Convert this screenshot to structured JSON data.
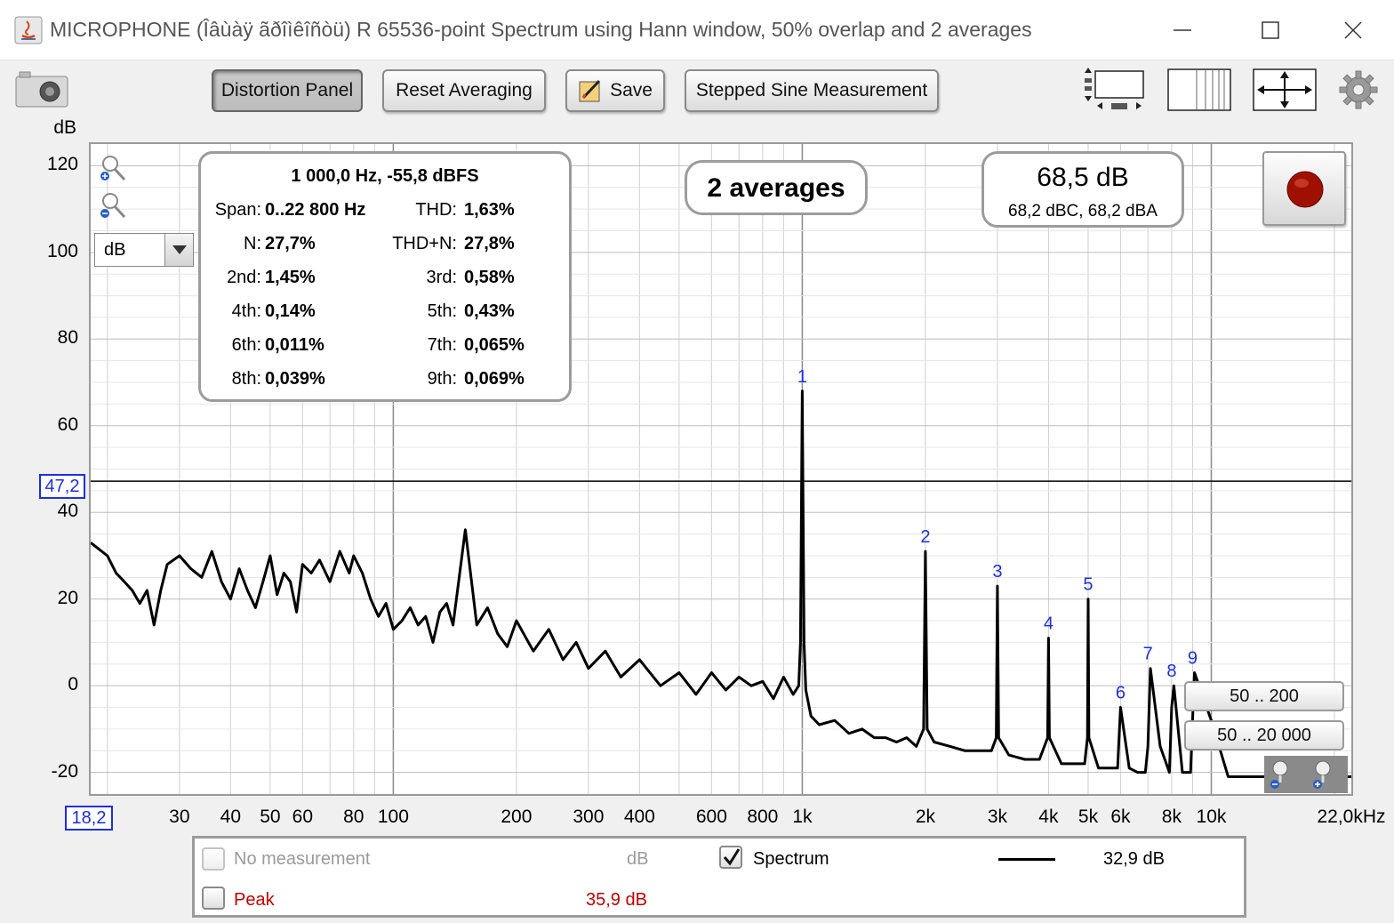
{
  "window": {
    "title": "MICROPHONE (Îâùàÿ ãðîìêîñòü) R 65536-point Spectrum using Hann window, 50% overlap and 2 averages"
  },
  "toolbar": {
    "distortion_panel": "Distortion Panel",
    "reset_averaging": "Reset Averaging",
    "save": "Save",
    "stepped_sine": "Stepped Sine Measurement"
  },
  "plot": {
    "y_unit": "dB",
    "unit_select_value": "dB",
    "y_ticks": [
      "120",
      "100",
      "80",
      "60",
      "40",
      "20",
      "0",
      "-20"
    ],
    "x_ticks": [
      "30",
      "40",
      "50",
      "60",
      "80",
      "100",
      "200",
      "300",
      "400",
      "600",
      "800",
      "1k",
      "2k",
      "3k",
      "4k",
      "5k",
      "6k",
      "8k",
      "10k",
      "22,0kHz"
    ],
    "x_start_label": "18,2",
    "cursor_level_label": "47,2",
    "harmonic_markers": [
      "1",
      "2",
      "3",
      "4",
      "5",
      "6",
      "7",
      "8",
      "9"
    ]
  },
  "distortion": {
    "header": "1 000,0 Hz, -55,8 dBFS",
    "rows": [
      {
        "l1": "Span:",
        "v1": "0..22 800 Hz",
        "l2": "THD:",
        "v2": "1,63%"
      },
      {
        "l1": "N:",
        "v1": "27,7%",
        "l2": "THD+N:",
        "v2": "27,8%"
      },
      {
        "l1": "2nd:",
        "v1": "1,45%",
        "l2": "3rd:",
        "v2": "0,58%"
      },
      {
        "l1": "4th:",
        "v1": "0,14%",
        "l2": "5th:",
        "v2": "0,43%"
      },
      {
        "l1": "6th:",
        "v1": "0,011%",
        "l2": "7th:",
        "v2": "0,065%"
      },
      {
        "l1": "8th:",
        "v1": "0,039%",
        "l2": "9th:",
        "v2": "0,069%"
      }
    ]
  },
  "averages_label": "2 averages",
  "level": {
    "main": "68,5 dB",
    "sub": "68,2 dBC, 68,2 dBA"
  },
  "range_buttons": {
    "a": "50 .. 200",
    "b": "50 .. 20 000"
  },
  "legend": {
    "no_measurement": "No measurement",
    "no_measurement_unit": "dB",
    "spectrum": "Spectrum",
    "spectrum_value": "32,9 dB",
    "peak": "Peak",
    "peak_value": "35,9 dB"
  },
  "colors": {
    "marker_blue": "#1d2fe0",
    "peak_red": "#c00000",
    "record_red": "#a01000"
  },
  "chart_data": {
    "type": "line",
    "xscale": "log",
    "xlim": [
      18.2,
      22000
    ],
    "ylim": [
      -25,
      125
    ],
    "grid": true,
    "series": [
      {
        "name": "Spectrum",
        "x": [
          18.2,
          20,
          21,
          22,
          23,
          24,
          25,
          26,
          27,
          28,
          30,
          32,
          34,
          36,
          38,
          40,
          42,
          44,
          46,
          48,
          50,
          52,
          54,
          56,
          58,
          60,
          63,
          66,
          70,
          74,
          78,
          80,
          84,
          88,
          92,
          96,
          100,
          105,
          110,
          115,
          120,
          125,
          130,
          135,
          140,
          150,
          160,
          170,
          180,
          190,
          200,
          220,
          240,
          260,
          280,
          300,
          330,
          360,
          400,
          450,
          500,
          550,
          600,
          650,
          700,
          750,
          800,
          850,
          900,
          950,
          980,
          990,
          1000,
          1010,
          1020,
          1050,
          1100,
          1200,
          1300,
          1400,
          1500,
          1600,
          1700,
          1800,
          1900,
          1980,
          2000,
          2020,
          2100,
          2300,
          2500,
          2700,
          2900,
          2980,
          3000,
          3020,
          3200,
          3500,
          3800,
          3980,
          4000,
          4020,
          4300,
          4600,
          4900,
          4980,
          5000,
          5020,
          5300,
          5600,
          5900,
          6000,
          6300,
          6600,
          6900,
          7000,
          7100,
          7500,
          7900,
          8000,
          8100,
          8500,
          8900,
          9000,
          9100,
          10000,
          11000,
          12000,
          13000,
          14000,
          15000,
          16000,
          17000,
          18000,
          19000,
          20000,
          21000,
          22000
        ],
        "y": [
          33,
          30,
          26,
          24,
          22,
          19,
          22,
          14,
          22,
          28,
          30,
          27,
          25,
          31,
          24,
          20,
          27,
          22,
          18,
          24,
          30,
          21,
          26,
          24,
          17,
          28,
          26,
          29,
          24,
          31,
          26,
          30,
          26,
          20,
          16,
          19,
          13,
          15,
          18,
          14,
          16,
          10,
          17,
          19,
          14,
          36,
          14,
          18,
          12,
          9,
          15,
          8,
          13,
          6,
          10,
          4,
          8,
          2,
          6,
          0,
          3,
          -2,
          3,
          -1,
          2,
          0,
          1,
          -3,
          2,
          -2,
          0,
          10,
          68,
          10,
          -1,
          -7,
          -9,
          -8,
          -11,
          -10,
          -12,
          -12,
          -13,
          -12,
          -14,
          -10,
          31,
          -10,
          -13,
          -14,
          -15,
          -15,
          -15,
          -12,
          23,
          -12,
          -16,
          -17,
          -17,
          -12,
          11,
          -12,
          -18,
          -18,
          -18,
          -12,
          20,
          -12,
          -19,
          -19,
          -19,
          -5,
          -19,
          -20,
          -20,
          -14,
          4,
          -14,
          -20,
          -5,
          0,
          -20,
          -20,
          -8,
          3,
          -8,
          -21,
          -21,
          -21,
          -21,
          -21,
          -21,
          -21,
          -21,
          -21,
          -21,
          -21,
          -21
        ]
      }
    ],
    "markers": [
      {
        "label": "1",
        "x": 1000,
        "y": 68
      },
      {
        "label": "2",
        "x": 2000,
        "y": 31
      },
      {
        "label": "3",
        "x": 3000,
        "y": 23
      },
      {
        "label": "4",
        "x": 4000,
        "y": 11
      },
      {
        "label": "5",
        "x": 5000,
        "y": 20
      },
      {
        "label": "6",
        "x": 6000,
        "y": -5
      },
      {
        "label": "7",
        "x": 7000,
        "y": 4
      },
      {
        "label": "8",
        "x": 8000,
        "y": 0
      },
      {
        "label": "9",
        "x": 9000,
        "y": 3
      }
    ],
    "cursor_y": 47.2
  }
}
